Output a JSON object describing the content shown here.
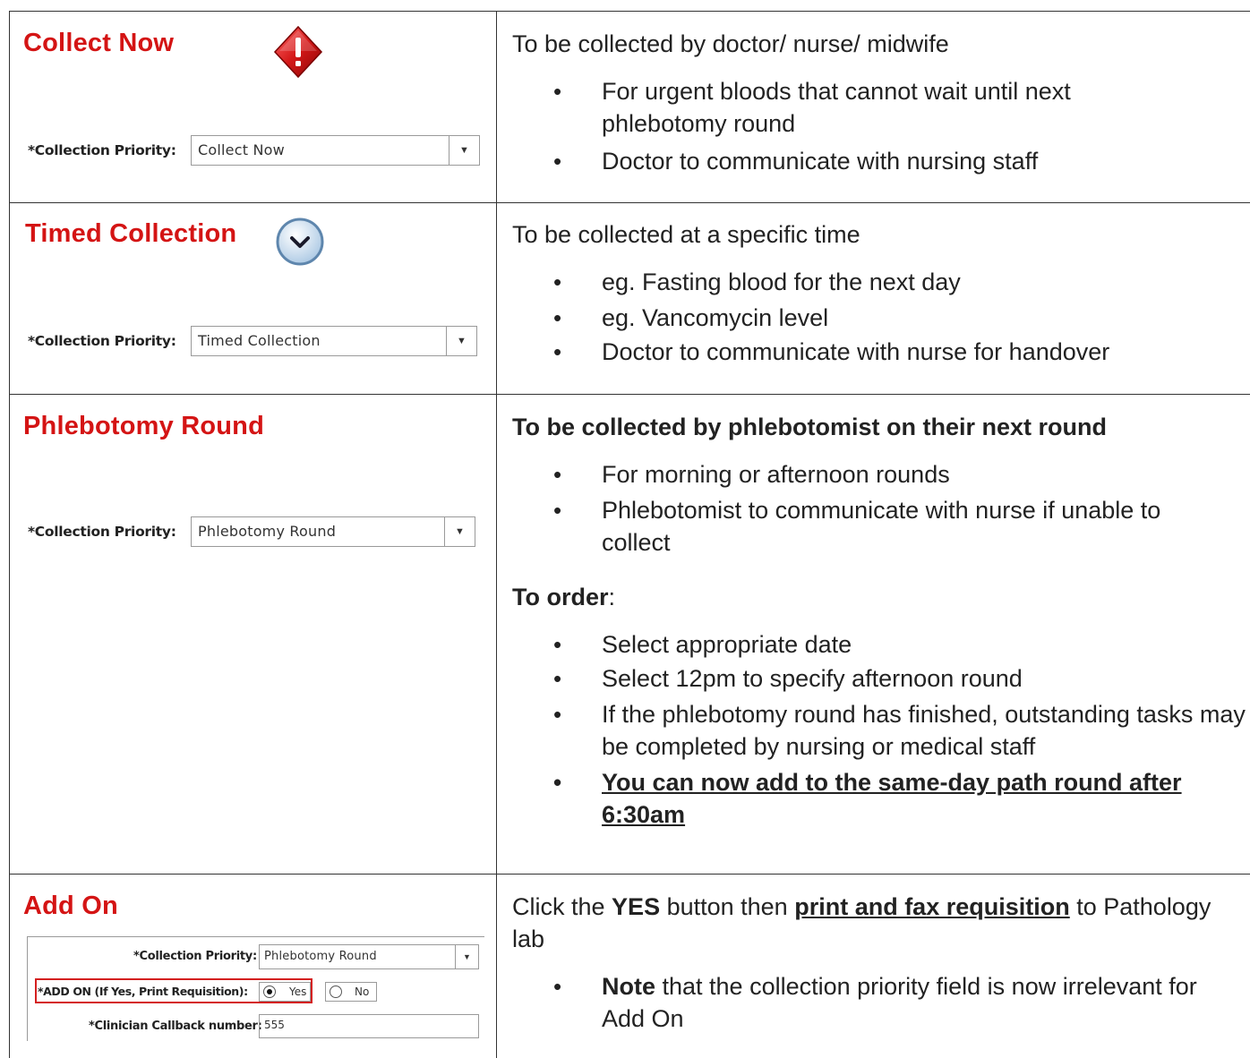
{
  "rows": [
    {
      "heading": "Collect Now",
      "icon": "red-diamond-alert-icon",
      "priority_label": "*Collection Priority:",
      "priority_value": "Collect Now",
      "desc_title": "To be collected by doctor/ nurse/ midwife",
      "bullets": [
        "For urgent bloods that cannot wait until next phlebotomy round",
        "Doctor to communicate with nursing staff"
      ]
    },
    {
      "heading": "Timed Collection",
      "icon": "clock-chevron-icon",
      "priority_label": "*Collection Priority:",
      "priority_value": "Timed Collection",
      "desc_title": "To be collected at a specific time",
      "bullets": [
        "eg. Fasting blood for the next day",
        "eg. Vancomycin level",
        "Doctor to communicate with nurse for handover"
      ]
    },
    {
      "heading": "Phlebotomy Round",
      "priority_label": "*Collection Priority:",
      "priority_value": "Phlebotomy Round",
      "desc_title": "To be collected by phlebotomist on their next round",
      "bullets": [
        "For morning or afternoon rounds",
        "Phlebotomist to communicate with nurse if unable to collect"
      ],
      "order_title": "To order",
      "order_colon": ":",
      "order_bullets": [
        "Select appropriate date",
        "Select 12pm to specify afternoon round",
        "If the phlebotomy round has finished, outstanding tasks may be completed by nursing or medical staff"
      ],
      "order_emphasis": "You can now add to the same-day path round after 6:30am"
    },
    {
      "heading": "Add On",
      "priority_label": "*Collection Priority:",
      "priority_value": "Phlebotomy Round",
      "addon_label": "*ADD ON (If Yes, Print Requisition):",
      "yes_label": "Yes",
      "no_label": "No",
      "callback_label": "*Clinician Callback number:",
      "callback_value": "555",
      "desc_pre": "Click the ",
      "desc_yes": "YES",
      "desc_mid": " button then ",
      "desc_link": "print and fax requisition",
      "desc_post": " to Pathology lab",
      "note_bold": "Note",
      "note_rest": " that the collection priority field is now irrelevant for Add On"
    }
  ],
  "colors": {
    "heading": "#d41414",
    "border": "#333333",
    "highlight_box": "#d42020"
  }
}
